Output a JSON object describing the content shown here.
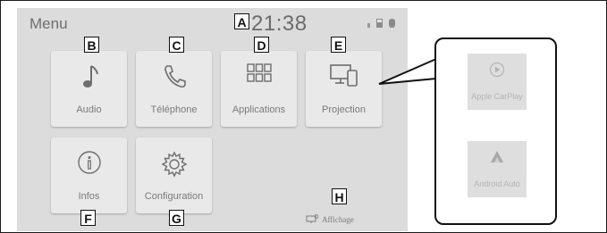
{
  "screen": {
    "title": "Menu",
    "clock": "21:38",
    "status_icons": [
      "signal-icon",
      "battery-icon",
      "bluetooth-icon"
    ]
  },
  "tiles": [
    {
      "label": "Audio",
      "icon": "music-note-icon"
    },
    {
      "label": "Téléphone",
      "icon": "phone-icon"
    },
    {
      "label": "Applications",
      "icon": "app-grid-icon"
    },
    {
      "label": "Projection",
      "icon": "projection-icon"
    },
    {
      "label": "Infos",
      "icon": "info-icon"
    },
    {
      "label": "Configuration",
      "icon": "gear-icon"
    }
  ],
  "affichage": {
    "label": "Affichage",
    "icon": "display-icon"
  },
  "callout": {
    "items": [
      {
        "label": "Apple CarPlay",
        "icon": "carplay-icon"
      },
      {
        "label": "Android Auto",
        "icon": "android-auto-icon"
      }
    ]
  },
  "markers": [
    "A",
    "B",
    "C",
    "D",
    "E",
    "F",
    "G",
    "H"
  ],
  "colors": {
    "screen_bg": "#dcdcdc",
    "tile_bg": "#e9e9e9",
    "text": "#7a7a7a"
  }
}
